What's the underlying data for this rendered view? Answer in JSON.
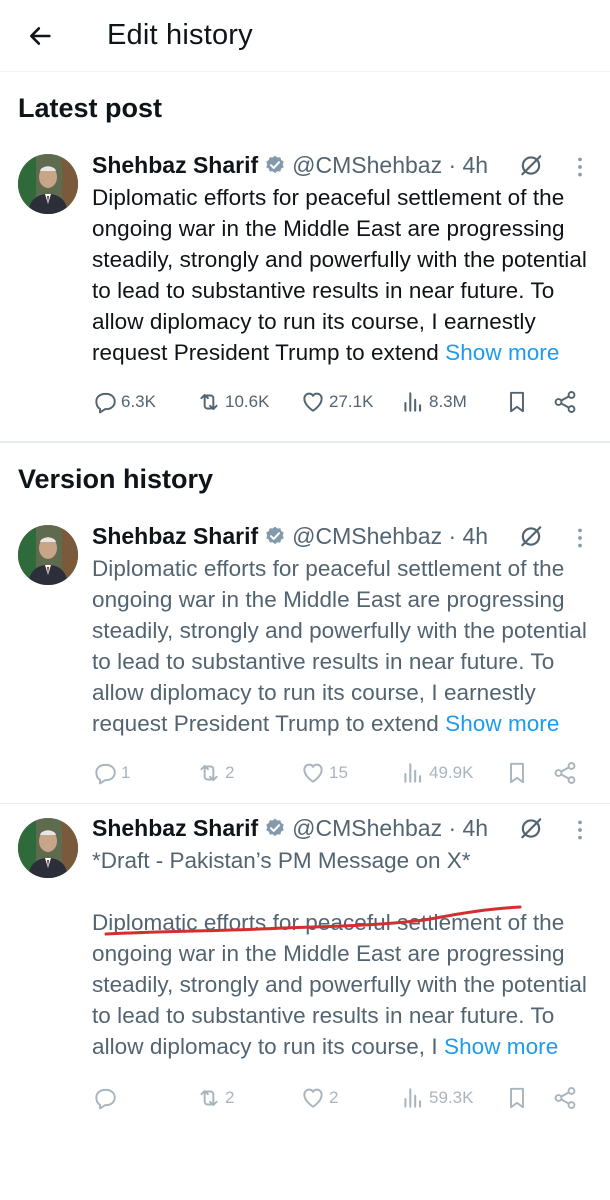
{
  "header": {
    "title": "Edit history"
  },
  "latest": {
    "section_title": "Latest post",
    "post": {
      "name": "Shehbaz Sharif",
      "handle": "@CMShehbaz · 4h",
      "text": "Diplomatic efforts for peaceful settlement of the ongoing war in the Middle East are progressing steadily, strongly and powerfully with the potential to lead to substantive results in near future. To allow diplomacy to run its course, I earnestly request President Trump to extend",
      "show_more": "Show more",
      "replies": "6.3K",
      "reposts": "10.6K",
      "likes": "27.1K",
      "views": "8.3M"
    }
  },
  "history": {
    "section_title": "Version history",
    "versions": [
      {
        "name": "Shehbaz Sharif",
        "handle": "@CMShehbaz · 4h",
        "text": "Diplomatic efforts for peaceful settlement of the ongoing war in the Middle East are progressing steadily, strongly and powerfully with the potential to lead to substantive results in near future. To allow diplomacy to run its course, I earnestly request President Trump to extend",
        "show_more": "Show more",
        "replies": "1",
        "reposts": "2",
        "likes": "15",
        "views": "49.9K"
      },
      {
        "name": "Shehbaz Sharif",
        "handle": "@CMShehbaz · 4h",
        "draft_line": "*Draft - Pakistan’s PM Message on X*",
        "text": "Diplomatic efforts for peaceful settlement of the ongoing war in the Middle East are progressing steadily, strongly and powerfully with the potential to lead to substantive results in near future. To allow diplomacy to run its course, I",
        "show_more": "Show more",
        "replies": "",
        "reposts": "2",
        "likes": "2",
        "views": "59.3K"
      }
    ]
  },
  "colors": {
    "text": "#0f1419",
    "muted": "#536471",
    "link": "#1d9bf0",
    "verified": "#829aab",
    "annotation": "#d32f2f"
  },
  "icons": [
    "back-arrow-icon",
    "verified-badge-icon",
    "edit-icon",
    "more-icon",
    "reply-icon",
    "repost-icon",
    "like-icon",
    "views-icon",
    "bookmark-icon",
    "share-icon"
  ]
}
